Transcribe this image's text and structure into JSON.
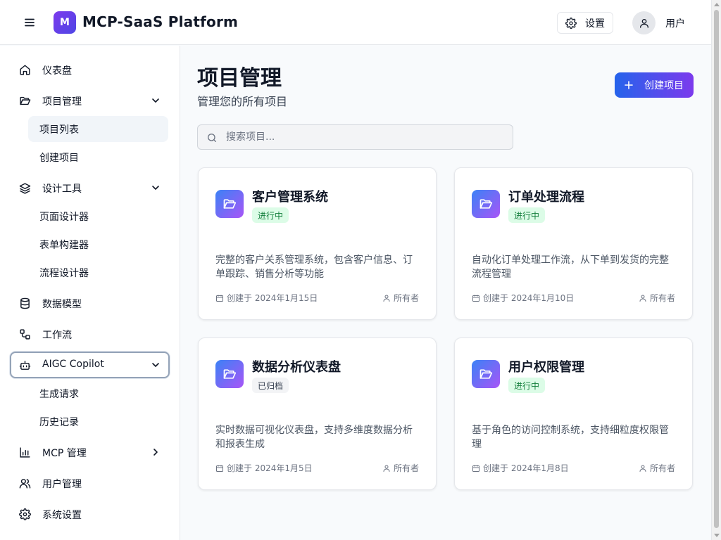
{
  "header": {
    "brand_letter": "M",
    "brand_title": "MCP-SaaS Platform",
    "settings_label": "设置",
    "user_label": "用户"
  },
  "sidebar": {
    "items": [
      {
        "label": "仪表盘",
        "icon": "home-icon"
      },
      {
        "label": "项目管理",
        "icon": "folder-icon",
        "expanded": true
      },
      {
        "label": "设计工具",
        "icon": "layers-icon",
        "expanded": true
      },
      {
        "label": "数据模型",
        "icon": "database-icon"
      },
      {
        "label": "工作流",
        "icon": "workflow-icon"
      },
      {
        "label": "AIGC Copilot",
        "icon": "bot-icon",
        "expanded": true
      },
      {
        "label": "MCP 管理",
        "icon": "bar-chart-icon",
        "expanded": false
      },
      {
        "label": "用户管理",
        "icon": "users-icon"
      },
      {
        "label": "系统设置",
        "icon": "gear-icon"
      }
    ],
    "project_sub": [
      "项目列表",
      "创建项目"
    ],
    "design_sub": [
      "页面设计器",
      "表单构建器",
      "流程设计器"
    ],
    "aigc_sub": [
      "生成请求",
      "历史记录"
    ]
  },
  "main": {
    "title": "项目管理",
    "subtitle": "管理您的所有项目",
    "create_label": "创建项目",
    "search_placeholder": "搜索项目..."
  },
  "projects": [
    {
      "name": "客户管理系统",
      "status": "进行中",
      "description": "完整的客户关系管理系统，包含客户信息、订单跟踪、销售分析等功能",
      "date": "创建于 2024年1月15日",
      "owner": "所有者"
    },
    {
      "name": "订单处理流程",
      "status": "进行中",
      "description": "自动化订单处理工作流，从下单到发货的完整流程管理",
      "date": "创建于 2024年1月10日",
      "owner": "所有者"
    },
    {
      "name": "数据分析仪表盘",
      "status": "已归档",
      "description": "实时数据可视化仪表盘，支持多维度数据分析和报表生成",
      "date": "创建于 2024年1月5日",
      "owner": "所有者"
    },
    {
      "name": "用户权限管理",
      "status": "进行中",
      "description": "基于角色的访问控制系统，支持细粒度权限管理",
      "date": "创建于 2024年1月8日",
      "owner": "所有者"
    }
  ],
  "colors": {
    "accent_start": "#2563eb",
    "accent_end": "#7c3aed",
    "status_active_bg": "#dcfce7",
    "status_active_fg": "#15803d",
    "status_archived_bg": "#f3f4f6"
  }
}
